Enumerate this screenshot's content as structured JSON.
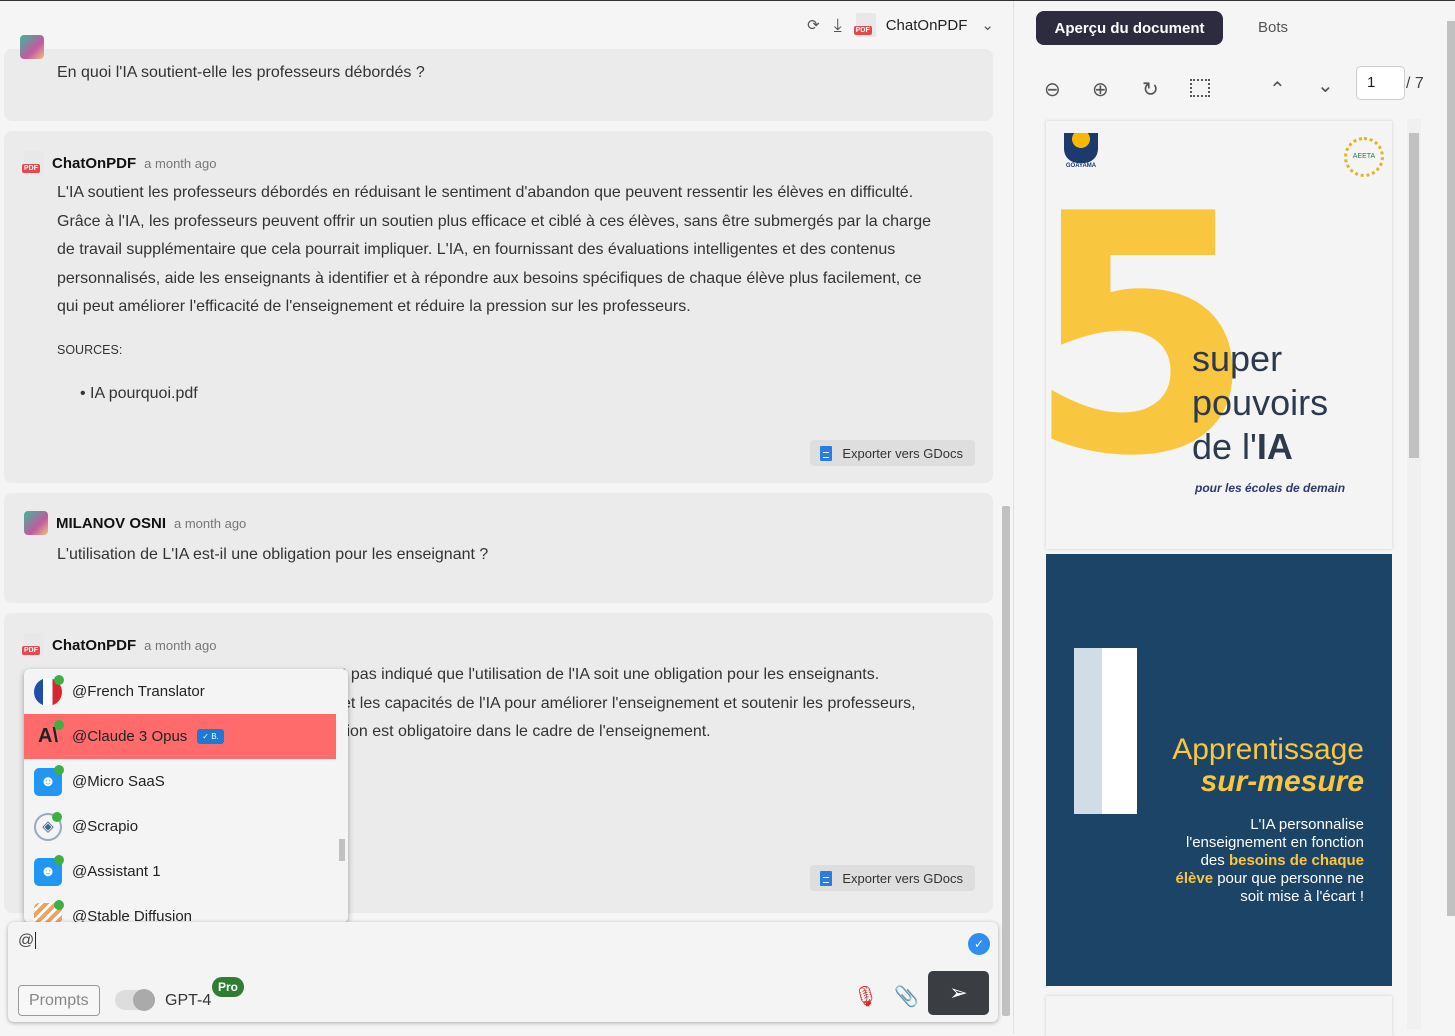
{
  "header": {
    "app_name": "ChatOnPDF",
    "icons": [
      "refresh-icon",
      "download-icon",
      "pdf-icon",
      "chevron-down-icon"
    ]
  },
  "messages": [
    {
      "author": "",
      "time": "",
      "text": "En quoi l'IA soutient-elle les professeurs débordés ?"
    },
    {
      "author": "ChatOnPDF",
      "time": "a month ago",
      "text": "L'IA soutient les professeurs débordés en réduisant le sentiment d'abandon que peuvent ressentir les élèves en difficulté. Grâce à l'IA, les professeurs peuvent offrir un soutien plus efficace et ciblé à ces élèves, sans être submergés par la charge de travail supplémentaire que cela pourrait impliquer. L'IA, en fournissant des évaluations intelligentes et des contenus personnalisés, aide les enseignants à identifier et à répondre aux besoins spécifiques de chaque élève plus facilement, ce qui peut améliorer l'efficacité de l'enseignement et réduire la pression sur les professeurs.",
      "sources_label": "SOURCES:",
      "sources": [
        "IA pourquoi.pdf"
      ],
      "export": "Exporter vers GDocs"
    },
    {
      "author": "MILANOV OSNI",
      "time": "a month ago",
      "text": "L'utilisation de L'IA est-il une obligation pour les enseignant ?"
    },
    {
      "author": "ChatOnPDF",
      "time": "a month ago",
      "lines": [
        "t pas indiqué que l'utilisation de l'IA soit une obligation pour les enseignants.",
        "et les capacités de l'IA pour améliorer l'enseignement et soutenir les professeurs,",
        "tion est obligatoire dans le cadre de l'enseignement."
      ],
      "export": "Exporter vers GDocs"
    }
  ],
  "bot_menu": [
    {
      "label": "@French Translator",
      "icon": "french-flag-icon"
    },
    {
      "label": "@Claude 3 Opus",
      "icon": "anthropic-icon",
      "selected": true,
      "badge": "✓ B."
    },
    {
      "label": "@Micro SaaS",
      "icon": "robot-icon"
    },
    {
      "label": "@Scrapio",
      "icon": "globe-icon"
    },
    {
      "label": "@Assistant 1",
      "icon": "robot-icon"
    },
    {
      "label": "@Stable Diffusion",
      "icon": "stable-diffusion-icon"
    }
  ],
  "composer": {
    "value": "@",
    "prompts": "Prompts",
    "model": "GPT-4",
    "pro_badge": "Pro",
    "toggle_on": false
  },
  "preview": {
    "tab_active": "Aperçu du document",
    "tab_bots": "Bots",
    "page_current": "1",
    "page_total": "/ 7"
  },
  "pdf": {
    "page1": {
      "logo_left": "GOAYAMA",
      "logo_right": "AEETA",
      "big_number": "5",
      "title_lines": [
        "super",
        "pouvoirs",
        "de l'"
      ],
      "title_bold": "IA",
      "subtitle": "pour les écoles de demain"
    },
    "page2": {
      "number": "1",
      "title1": "Apprentissage",
      "title2": "sur-mesure",
      "body1": "L'IA personnalise",
      "body2": "l'enseignement en fonction",
      "body3a": "des ",
      "body3b": "besoins de chaque",
      "body4a": "élève",
      "body4b": " pour que personne ne",
      "body5": "soit mise à l'écart !"
    }
  },
  "colors": {
    "selected": "#ff6b6b",
    "accent_yellow": "#f9c73f",
    "page_blue": "#1c4467",
    "send": "#3a3d42"
  }
}
